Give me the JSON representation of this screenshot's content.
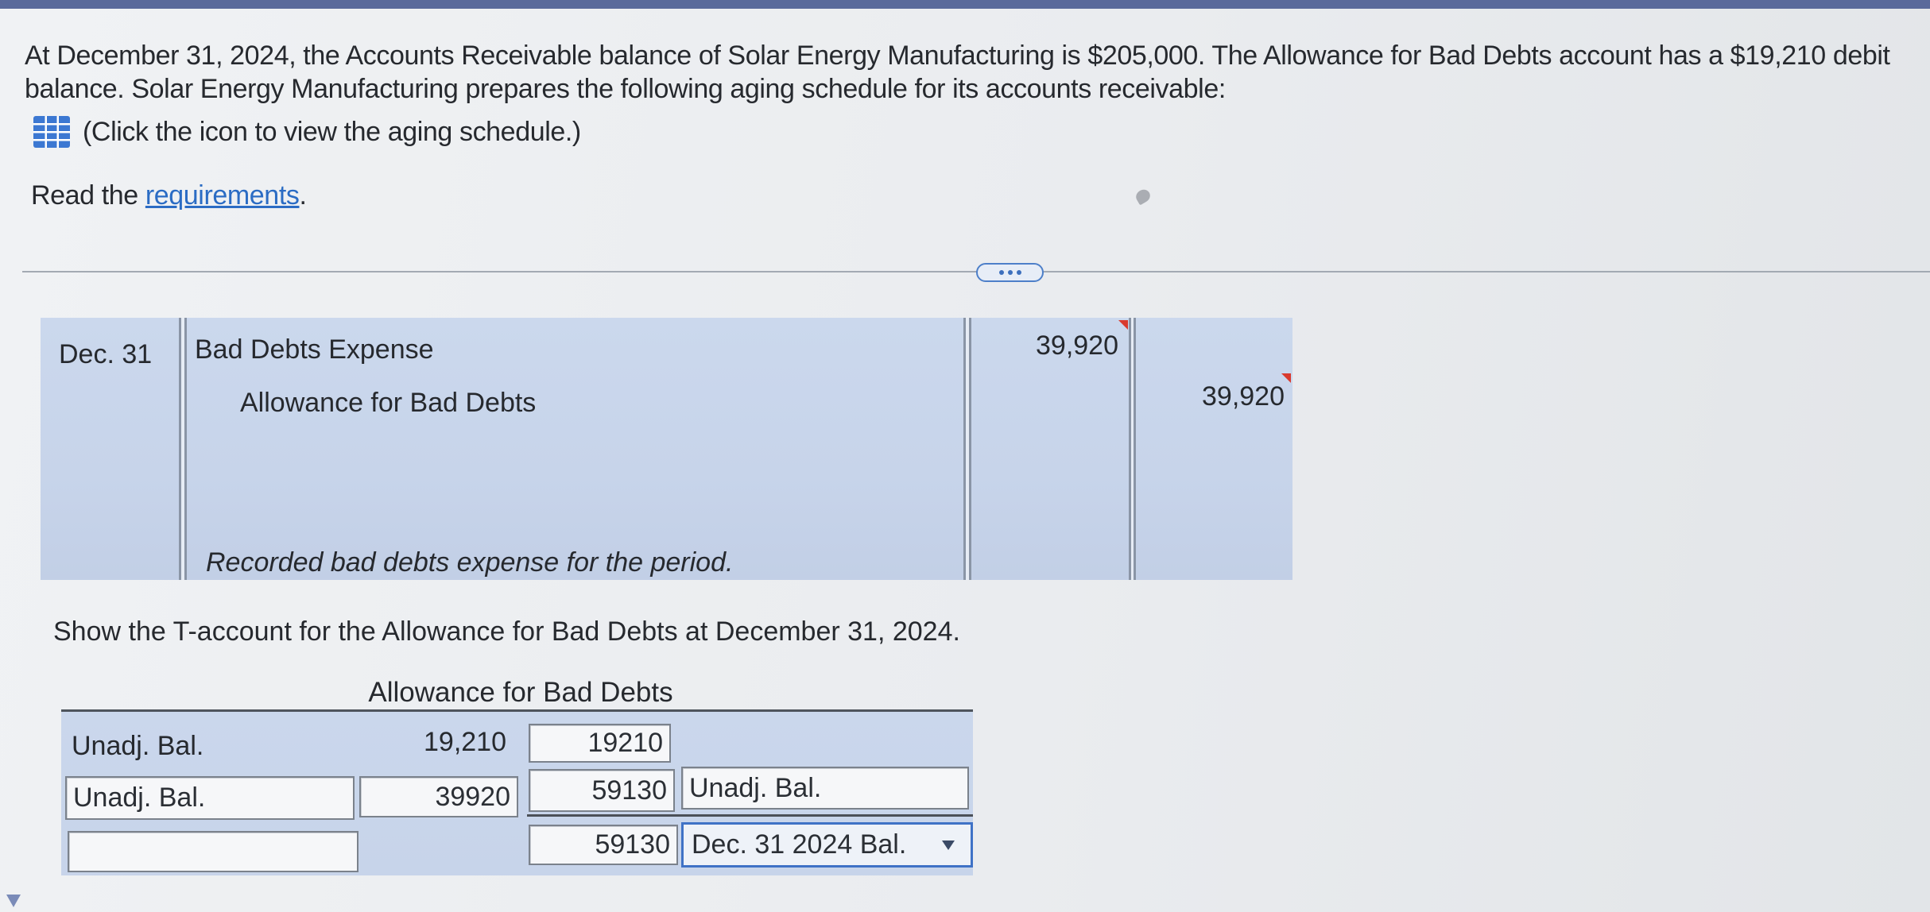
{
  "problem": {
    "intro_line_1": "At December 31, 2024, the Accounts Receivable balance of Solar Energy Manufacturing is $205,000. The Allowance for Bad Debts account has a $19,210 debit",
    "intro_line_2": "balance. Solar Energy Manufacturing prepares the following aging schedule for its accounts receivable:",
    "aging_schedule_icon": "table-grid-icon",
    "aging_schedule_text": "(Click the icon to view the aging schedule.)",
    "read_prefix": "Read the",
    "requirements_link": "requirements",
    "read_suffix": "."
  },
  "section_divider": {
    "expand_icon": "ellipsis-icon"
  },
  "journal_entry": {
    "date": "Dec. 31",
    "debit_account": "Bad Debts Expense",
    "credit_account": "Allowance for Bad Debts",
    "debit_amount": "39,920",
    "credit_amount": "39,920",
    "explanation": "Recorded bad debts expense for the period."
  },
  "t_account_instruction": "Show the T-account for the Allowance for Bad Debts at December 31, 2024.",
  "t_account": {
    "title": "Allowance for Bad Debts",
    "rows": [
      {
        "left_label": "Unadj. Bal.",
        "left_amount": "19,210",
        "right_amount": "19210"
      },
      {
        "left_label": "Unadj. Bal.",
        "left_amount": "39920",
        "right_amount": "59130",
        "right_label": "Unadj. Bal."
      },
      {
        "left_label": "",
        "right_amount": "59130",
        "right_label": "Dec. 31 2024 Bal."
      }
    ]
  },
  "colors": {
    "text": "#26292e",
    "top_bar": "#5a6a9b",
    "link": "#2b6cc4",
    "entry_background": "#c7d4ea",
    "flag": "#d93a2e",
    "focus_border": "#3f72c6",
    "icon_blue": "#3c78d2"
  }
}
